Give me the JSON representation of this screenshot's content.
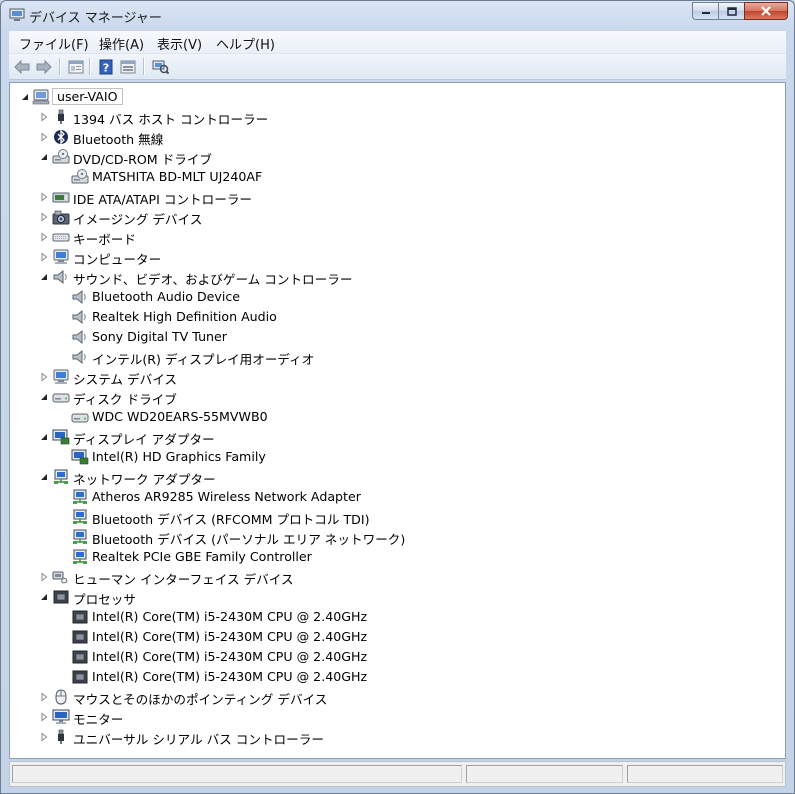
{
  "window": {
    "title": "デバイス マネージャー"
  },
  "menu": {
    "file": "ファイル(F)",
    "action": "操作(A)",
    "view": "表示(V)",
    "help": "ヘルプ(H)"
  },
  "toolbar": {
    "back": "back-arrow-icon",
    "forward": "forward-arrow-icon",
    "properties": "properties-icon",
    "help": "help-icon",
    "view": "view-icon",
    "scan": "scan-hardware-icon"
  },
  "tree": {
    "root": "user-VAIO",
    "nodes": [
      {
        "label": "1394 バス ホスト コントローラー",
        "icon": "usb",
        "level": 1,
        "state": "collapsed"
      },
      {
        "label": "Bluetooth 無線",
        "icon": "bluetooth",
        "level": 1,
        "state": "collapsed"
      },
      {
        "label": "DVD/CD-ROM ドライブ",
        "icon": "dvd",
        "level": 1,
        "state": "expanded"
      },
      {
        "label": "MATSHITA BD-MLT UJ240AF",
        "icon": "dvd",
        "level": 2,
        "state": "leaf"
      },
      {
        "label": "IDE ATA/ATAPI コントローラー",
        "icon": "ide",
        "level": 1,
        "state": "collapsed"
      },
      {
        "label": "イメージング デバイス",
        "icon": "camera",
        "level": 1,
        "state": "collapsed"
      },
      {
        "label": "キーボード",
        "icon": "keyboard",
        "level": 1,
        "state": "collapsed"
      },
      {
        "label": "コンピューター",
        "icon": "computer",
        "level": 1,
        "state": "collapsed"
      },
      {
        "label": "サウンド、ビデオ、およびゲーム コントローラー",
        "icon": "speaker",
        "level": 1,
        "state": "expanded"
      },
      {
        "label": "Bluetooth Audio Device",
        "icon": "speaker",
        "level": 2,
        "state": "leaf"
      },
      {
        "label": "Realtek High Definition Audio",
        "icon": "speaker",
        "level": 2,
        "state": "leaf"
      },
      {
        "label": "Sony Digital TV Tuner",
        "icon": "speaker",
        "level": 2,
        "state": "leaf"
      },
      {
        "label": "インテル(R) ディスプレイ用オーディオ",
        "icon": "speaker",
        "level": 2,
        "state": "leaf"
      },
      {
        "label": "システム デバイス",
        "icon": "computer",
        "level": 1,
        "state": "collapsed"
      },
      {
        "label": "ディスク ドライブ",
        "icon": "disk",
        "level": 1,
        "state": "expanded"
      },
      {
        "label": "WDC WD20EARS-55MVWB0",
        "icon": "disk",
        "level": 2,
        "state": "leaf"
      },
      {
        "label": "ディスプレイ アダプター",
        "icon": "display",
        "level": 1,
        "state": "expanded"
      },
      {
        "label": "Intel(R) HD Graphics Family",
        "icon": "display",
        "level": 2,
        "state": "leaf"
      },
      {
        "label": "ネットワーク アダプター",
        "icon": "network",
        "level": 1,
        "state": "expanded"
      },
      {
        "label": "Atheros AR9285 Wireless Network Adapter",
        "icon": "network",
        "level": 2,
        "state": "leaf"
      },
      {
        "label": "Bluetooth デバイス (RFCOMM プロトコル TDI)",
        "icon": "network",
        "level": 2,
        "state": "leaf"
      },
      {
        "label": "Bluetooth デバイス (パーソナル エリア ネットワーク)",
        "icon": "network",
        "level": 2,
        "state": "leaf"
      },
      {
        "label": "Realtek PCIe GBE Family Controller",
        "icon": "network",
        "level": 2,
        "state": "leaf"
      },
      {
        "label": "ヒューマン インターフェイス デバイス",
        "icon": "hid",
        "level": 1,
        "state": "collapsed"
      },
      {
        "label": "プロセッサ",
        "icon": "cpu",
        "level": 1,
        "state": "expanded"
      },
      {
        "label": "Intel(R) Core(TM) i5-2430M CPU @ 2.40GHz",
        "icon": "cpu",
        "level": 2,
        "state": "leaf"
      },
      {
        "label": "Intel(R) Core(TM) i5-2430M CPU @ 2.40GHz",
        "icon": "cpu",
        "level": 2,
        "state": "leaf"
      },
      {
        "label": "Intel(R) Core(TM) i5-2430M CPU @ 2.40GHz",
        "icon": "cpu",
        "level": 2,
        "state": "leaf"
      },
      {
        "label": "Intel(R) Core(TM) i5-2430M CPU @ 2.40GHz",
        "icon": "cpu",
        "level": 2,
        "state": "leaf"
      },
      {
        "label": "マウスとそのほかのポインティング デバイス",
        "icon": "mouse",
        "level": 1,
        "state": "collapsed"
      },
      {
        "label": "モニター",
        "icon": "monitor",
        "level": 1,
        "state": "collapsed"
      },
      {
        "label": "ユニバーサル シリアル バス コントローラー",
        "icon": "usb",
        "level": 1,
        "state": "collapsed"
      }
    ]
  }
}
